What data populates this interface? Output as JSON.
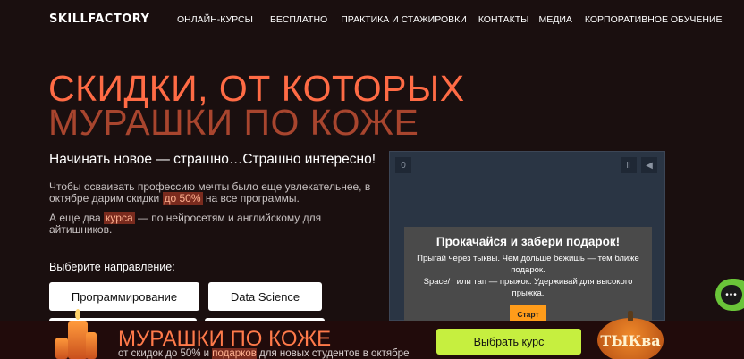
{
  "header": {
    "logo": "SKILLFACTORY",
    "menu": [
      "ОНЛАЙН-КУРСЫ",
      "БЕСПЛАТНО",
      "ПРАКТИКА И СТАЖИРОВКИ",
      "КОНТАКТЫ",
      "МЕДИА",
      "КОРПОРАТИВНОЕ ОБУЧЕНИЕ"
    ]
  },
  "hero": {
    "title_line1": "СКИДКИ, ОТ КОТОРЫХ",
    "title_line2": "МУРАШКИ ПО КОЖЕ",
    "lead": "Начинать новое — страшно…Страшно интересно!",
    "p1_a": "Чтобы осваивать профессию мечты было еще увлекательнее, в октябре дарим скидки ",
    "p1_hl": "до 50%",
    "p1_b": " на все программы.",
    "p2_a": "А еще два ",
    "p2_hl": "курса",
    "p2_b": " — по нейросетям и английскому для айтишников.",
    "direction_label": "Выберите направление:",
    "directions": [
      "Программирование",
      "Data Science"
    ]
  },
  "game": {
    "score": "0",
    "pause_icon": "II",
    "sound_icon": "◀",
    "title": "Прокачайся и забери подарок!",
    "text1": "Прыгай через тыквы. Чем дольше бежишь — тем ближе подарок.",
    "text2": "Space/↑ или тап — прыжок. Удерживай для высокого прыжка.",
    "start": "Старт"
  },
  "banner": {
    "headline": "МУРАШКИ ПО КОЖЕ",
    "sub_a": "от скидок до 50% и ",
    "sub_hl": "подарков",
    "sub_b": " для новых студентов в октябре",
    "cta": "Выбрать курс",
    "pumpkin_text": "ТЫКва"
  },
  "colors": {
    "accent": "#ff6b45",
    "background": "#1a0f0f",
    "cta": "#c6ef3f",
    "chat": "#6ac539"
  }
}
